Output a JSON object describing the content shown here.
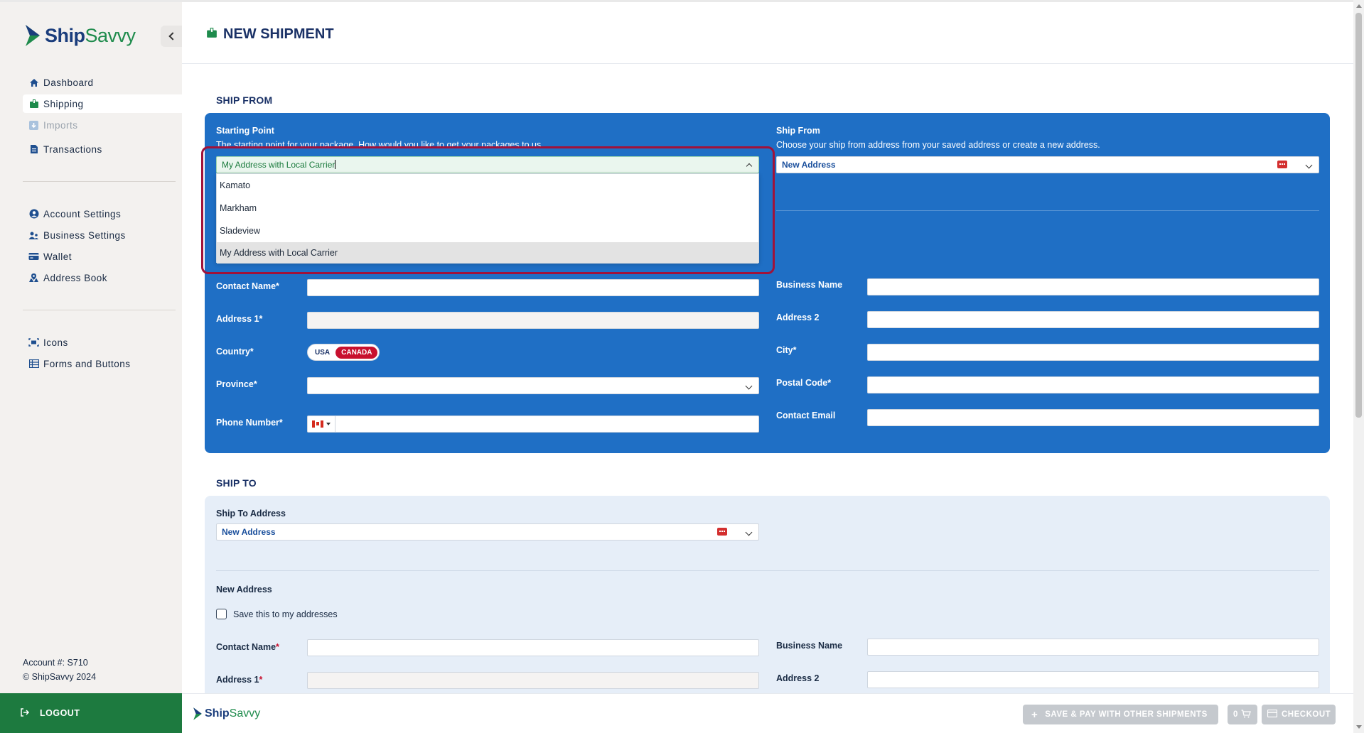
{
  "brand": {
    "ship": "Ship",
    "savvy": "Savvy"
  },
  "sidebar": {
    "items": [
      {
        "label": "Dashboard",
        "icon": "home-icon"
      },
      {
        "label": "Shipping",
        "icon": "package-icon"
      },
      {
        "label": "Imports",
        "icon": "imports-icon"
      },
      {
        "label": "Transactions",
        "icon": "document-icon"
      },
      {
        "label": "Account Settings",
        "icon": "user-circle-icon"
      },
      {
        "label": "Business Settings",
        "icon": "users-icon"
      },
      {
        "label": "Wallet",
        "icon": "wallet-icon"
      },
      {
        "label": "Address Book",
        "icon": "address-book-icon"
      },
      {
        "label": "Icons",
        "icon": "icons-icon"
      },
      {
        "label": "Forms and Buttons",
        "icon": "table-icon"
      }
    ],
    "account": "Account #: S710",
    "copyright": "© ShipSavvy 2024",
    "logout": "LOGOUT"
  },
  "header": {
    "title": "NEW SHIPMENT"
  },
  "ship_from": {
    "section_title": "SHIP FROM",
    "starting_point_label": "Starting Point",
    "starting_point_desc": "The starting point for your package. How would you like to get your packages to us",
    "starting_point_value": "My Address with Local Carrier",
    "options": [
      "Kamato",
      "Markham",
      "Sladeview",
      "My Address with Local Carrier"
    ],
    "ship_from_label": "Ship From",
    "ship_from_desc": "Choose your ship from address from your saved address or create a new address.",
    "ship_from_value": "New Address",
    "fields": {
      "contact_name": "Contact Name",
      "business_name": "Business Name",
      "address1": "Address 1",
      "address2": "Address 2",
      "country": "Country",
      "city": "City",
      "province": "Province",
      "postal_code": "Postal Code",
      "phone": "Phone Number",
      "email": "Contact Email",
      "required": "*"
    },
    "country_toggle": {
      "usa": "USA",
      "canada": "CANADA"
    }
  },
  "ship_to": {
    "section_title": "SHIP TO",
    "address_label": "Ship To Address",
    "address_value": "New Address",
    "new_address_heading": "New Address",
    "save_label": "Save this to my addresses",
    "contact_name": "Contact Name",
    "business_name": "Business Name",
    "address1": "Address 1",
    "address2": "Address 2",
    "required": "*"
  },
  "footer": {
    "save_pay": "SAVE & PAY WITH OTHER SHIPMENTS",
    "cart_count": "0",
    "checkout": "CHECKOUT"
  },
  "colors": {
    "primary_blue": "#1f6fc5",
    "brand_green": "#1d7a3f",
    "navy": "#1a3166",
    "accent_red": "#c8102e"
  }
}
